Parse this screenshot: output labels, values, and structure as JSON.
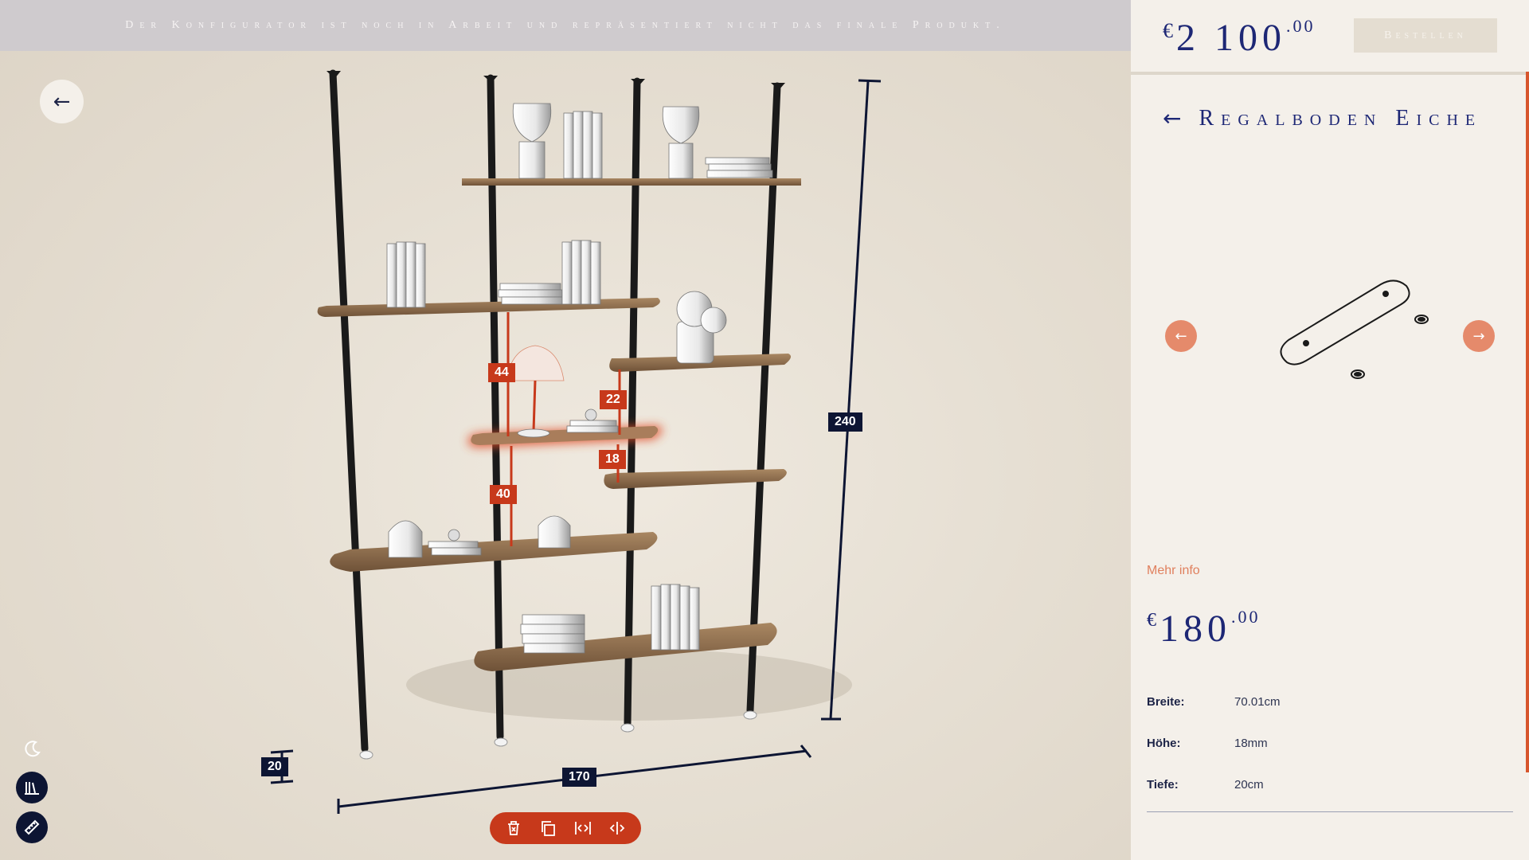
{
  "banner": {
    "text": "Der Konfigurator ist noch in Arbeit und repräsentiert nicht das finale Produkt."
  },
  "nav": {
    "back_icon": "arrow-left-icon",
    "back_glyph": "←"
  },
  "dimensions": {
    "height": "240",
    "width": "170",
    "depth": "20"
  },
  "selection_labels": {
    "above": "44",
    "below": "40",
    "right_top": "22",
    "right_bottom": "18"
  },
  "toolbar": {
    "items": [
      "delete-icon",
      "duplicate-icon",
      "shrink-width-icon",
      "expand-width-icon"
    ]
  },
  "side_tools": [
    "night-mode-icon",
    "library-icon",
    "ruler-icon"
  ],
  "panel": {
    "total_price": {
      "currency": "€",
      "main": "2 100",
      "decimals": ".00"
    },
    "order_button": "Bestellen",
    "back_glyph": "←",
    "title": "Regalboden Eiche",
    "prev_glyph": "←",
    "next_glyph": "→",
    "more_info": "Mehr info",
    "item_price": {
      "currency": "€",
      "main": "180",
      "decimals": ".00"
    },
    "specs": [
      {
        "label": "Breite:",
        "value": "70.01cm"
      },
      {
        "label": "Höhe:",
        "value": "18mm"
      },
      {
        "label": "Tiefe:",
        "value": "20cm"
      }
    ]
  },
  "colors": {
    "accent_red": "#c7391b",
    "navy": "#1d2775",
    "shelf_oak": "#8c6d4e",
    "banner_bg": "#cfcbce",
    "panel_bg": "#f4f0ea"
  }
}
